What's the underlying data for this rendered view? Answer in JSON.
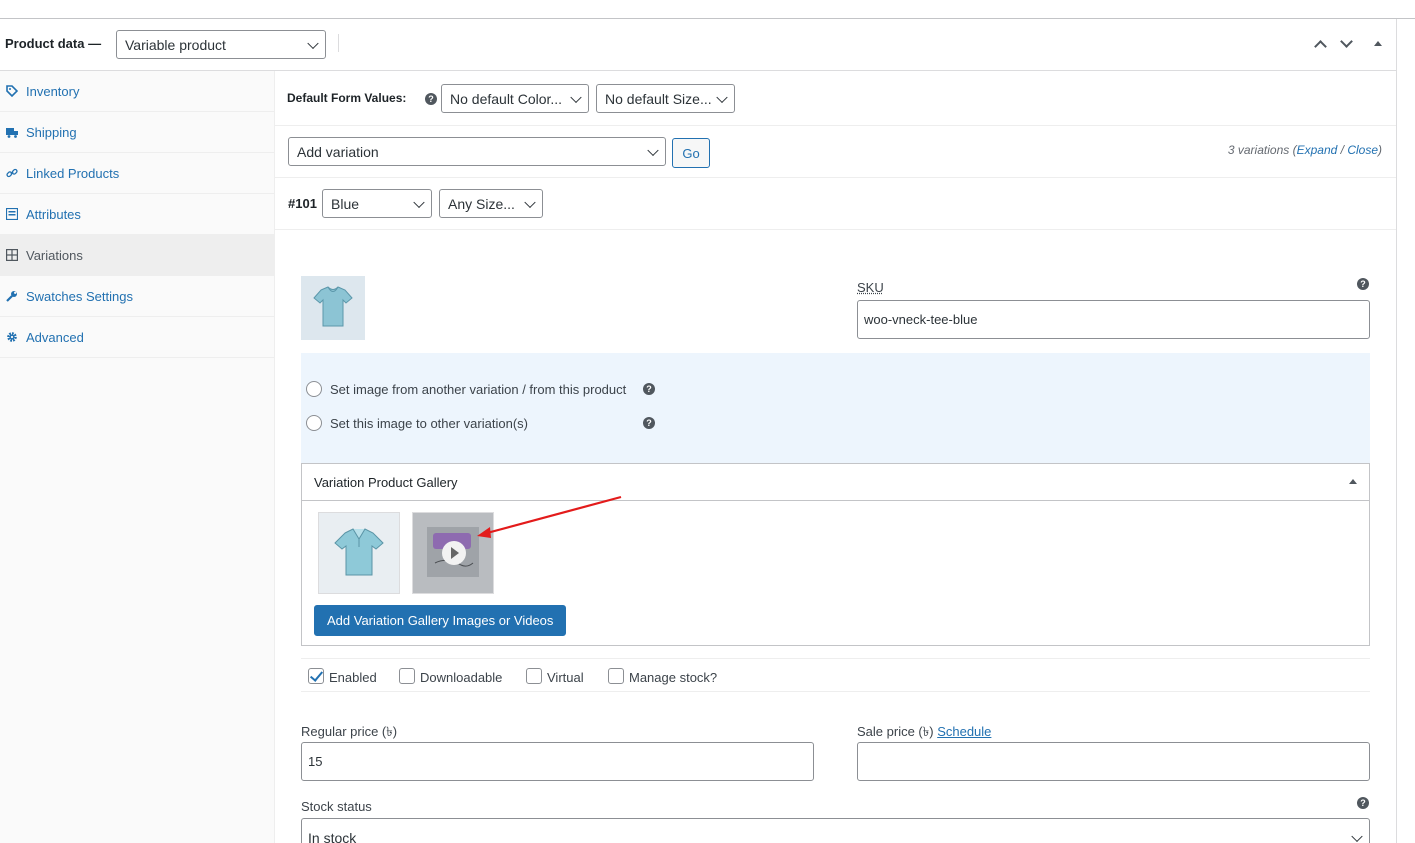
{
  "header": {
    "title": "Product data —",
    "product_type": "Variable product"
  },
  "tabs": [
    {
      "label": "Inventory",
      "icon": "tag-icon"
    },
    {
      "label": "Shipping",
      "icon": "truck-icon"
    },
    {
      "label": "Linked Products",
      "icon": "link-icon"
    },
    {
      "label": "Attributes",
      "icon": "list-icon"
    },
    {
      "label": "Variations",
      "icon": "grid-icon",
      "active": true
    },
    {
      "label": "Swatches Settings",
      "icon": "wrench-icon"
    },
    {
      "label": "Advanced",
      "icon": "gear-icon"
    }
  ],
  "defaults": {
    "label": "Default Form Values:",
    "color": "No default Color...",
    "size": "No default Size..."
  },
  "actions": {
    "select": "Add variation",
    "go": "Go",
    "count": "3 variations",
    "expand": "Expand",
    "close": "Close"
  },
  "variation": {
    "id": "#101",
    "color": "Blue",
    "size": "Any Size...",
    "sku_label": "SKU",
    "sku": "woo-vneck-tee-blue",
    "radio1": "Set image from another variation / from this product",
    "radio2": "Set this image to other variation(s)",
    "gallery_title": "Variation Product Gallery",
    "gallery_button": "Add Variation Gallery Images or Videos",
    "checks": {
      "enabled": "Enabled",
      "downloadable": "Downloadable",
      "virtual": "Virtual",
      "manage": "Manage stock?"
    },
    "regular_label": "Regular price (৳)",
    "regular_value": "15",
    "sale_label": "Sale price (৳)",
    "schedule": "Schedule",
    "sale_value": "",
    "stock_label": "Stock status",
    "stock_value": "In stock"
  },
  "colors": {
    "link": "#2271b1",
    "button": "#2271b1",
    "highlight": "#edf5fd",
    "arrow": "#e31b1b"
  }
}
